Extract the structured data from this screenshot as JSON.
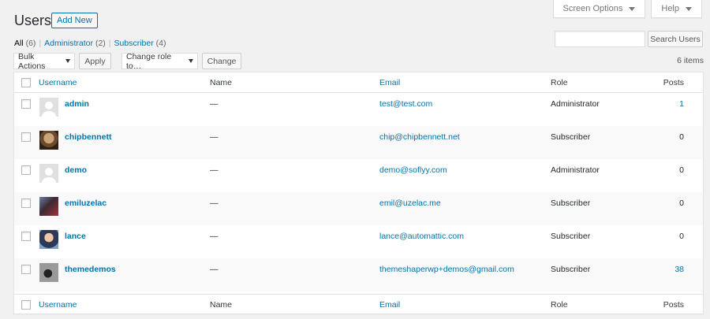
{
  "header": {
    "title": "Users",
    "add_new": "Add New",
    "screen_options": "Screen Options",
    "help": "Help"
  },
  "filters": {
    "all": "All",
    "all_count": "(6)",
    "administrator": "Administrator",
    "administrator_count": "(2)",
    "subscriber": "Subscriber",
    "subscriber_count": "(4)",
    "separator": "|"
  },
  "search": {
    "value": "",
    "button": "Search Users"
  },
  "tablenav": {
    "bulk_actions": "Bulk Actions",
    "apply": "Apply",
    "change_role": "Change role to…",
    "change": "Change",
    "items_count": "6 items"
  },
  "table": {
    "columns": {
      "username": "Username",
      "name": "Name",
      "email": "Email",
      "role": "Role",
      "posts": "Posts"
    },
    "rows": [
      {
        "username": "admin",
        "name": "—",
        "email": "test@test.com",
        "role": "Administrator",
        "posts": "1",
        "avatar": "default-avatar"
      },
      {
        "username": "chipbennett",
        "name": "—",
        "email": "chip@chipbennett.net",
        "role": "Subscriber",
        "posts": "0",
        "avatar": "photo-avatar"
      },
      {
        "username": "demo",
        "name": "—",
        "email": "demo@soflyy.com",
        "role": "Administrator",
        "posts": "0",
        "avatar": "default-avatar"
      },
      {
        "username": "emiluzelac",
        "name": "—",
        "email": "emil@uzelac.me",
        "role": "Subscriber",
        "posts": "0",
        "avatar": "photo-avatar"
      },
      {
        "username": "lance",
        "name": "—",
        "email": "lance@automattic.com",
        "role": "Subscriber",
        "posts": "0",
        "avatar": "photo-avatar"
      },
      {
        "username": "themedemos",
        "name": "—",
        "email": "themeshaperwp+demos@gmail.com",
        "role": "Subscriber",
        "posts": "38",
        "avatar": "photo-avatar"
      }
    ]
  },
  "colors": {
    "link": "#0073aa",
    "background": "#f1f1f1",
    "row_alt": "#f9f9f9"
  }
}
